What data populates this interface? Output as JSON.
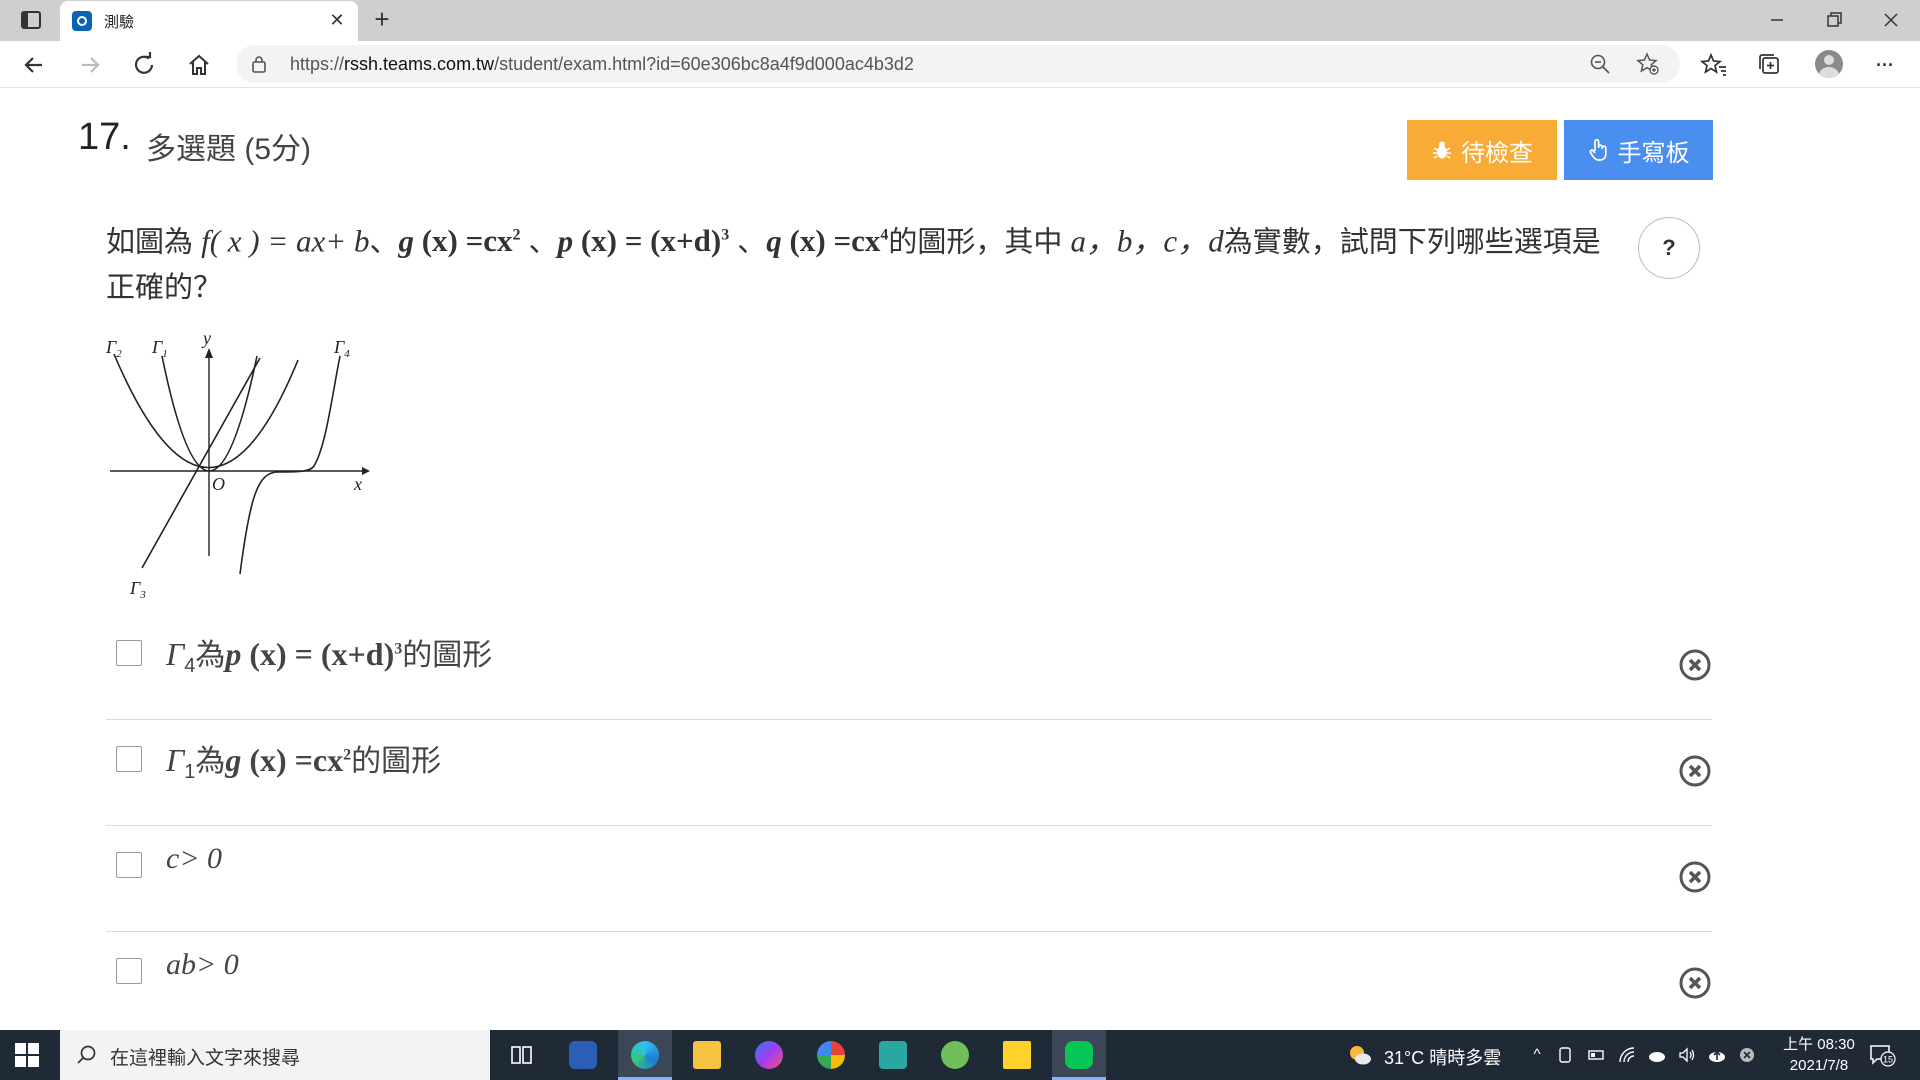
{
  "browser": {
    "tab_title": "測驗",
    "tab_close": "✕",
    "new_tab": "+",
    "url_prefix": "https://",
    "url_host": "rssh.teams.com.tw",
    "url_path": "/student/exam.html?id=60e306bc8a4f9d000ac4b3d2",
    "more": "···"
  },
  "question": {
    "number": "17.",
    "type_label": "多選題 (5分)",
    "review_label": "待檢查",
    "pad_label": "手寫板",
    "help_label": "?",
    "stem_prefix": "如圖為 ",
    "stem_f": "f",
    "stem_f_args": "( x ) = ax+ b",
    "stem_sep1": "、",
    "stem_g": "g",
    "stem_g_args": " (x) =cx",
    "stem_g_exp": "2",
    "stem_sep2": " 、",
    "stem_p": "p",
    "stem_p_args": " (x) = (x+d)",
    "stem_p_exp": "3",
    "stem_sep3": " 、",
    "stem_q": "q",
    "stem_q_args": " (x) =cx",
    "stem_q_exp": "4",
    "stem_mid": "的圖形，其中 ",
    "stem_vars": "a，b，c，d",
    "stem_suffix": "為實數，試問下列哪些選項是正確的？"
  },
  "graph": {
    "labels": {
      "g2": "Γ",
      "g2_sub": "2",
      "g1": "Γ",
      "g1_sub": "1",
      "g4": "Γ",
      "g4_sub": "4",
      "g3": "Γ",
      "g3_sub": "3",
      "y": "y",
      "x": "x",
      "origin": "O"
    }
  },
  "options": [
    {
      "gamma": "Γ",
      "sub": "4",
      "mid": "為",
      "fn": "p",
      "expr": " (x) = (x+d)",
      "exp": "3",
      "tail": "的圖形"
    },
    {
      "gamma": "Γ",
      "sub": "1",
      "mid": "為",
      "fn": "g",
      "expr": " (x) =cx",
      "exp": "2",
      "tail": "的圖形"
    },
    {
      "text": "c> 0"
    },
    {
      "text": "ab> 0"
    }
  ],
  "taskbar": {
    "search_placeholder": "在這裡輸入文字來搜尋",
    "weather": "31°C  晴時多雲",
    "time": "上午 08:30",
    "date": "2021/7/8",
    "notif_count": "15"
  }
}
